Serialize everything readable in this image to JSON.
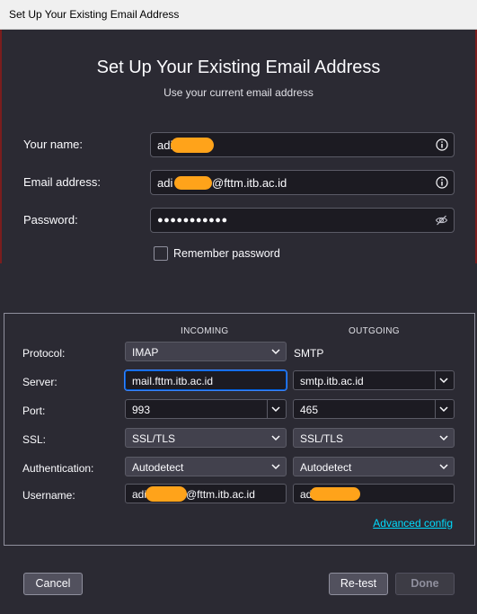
{
  "window": {
    "title": "Set Up Your Existing Email Address"
  },
  "header": {
    "title": "Set Up Your Existing Email Address",
    "subtitle": "Use your current email address"
  },
  "fields": {
    "name": {
      "label": "Your name:",
      "value": "adi"
    },
    "email": {
      "label": "Email address:",
      "value_prefix": "adi",
      "value_suffix": "@fttm.itb.ac.id"
    },
    "password": {
      "label": "Password:",
      "value": "●●●●●●●●●●●"
    }
  },
  "remember": {
    "label": "Remember password",
    "checked": false
  },
  "config": {
    "incoming_header": "INCOMING",
    "outgoing_header": "OUTGOING",
    "protocol": {
      "label": "Protocol:",
      "incoming": "IMAP",
      "outgoing": "SMTP"
    },
    "server": {
      "label": "Server:",
      "incoming": "mail.fttm.itb.ac.id",
      "outgoing": "smtp.itb.ac.id"
    },
    "port": {
      "label": "Port:",
      "incoming": "993",
      "outgoing": "465"
    },
    "ssl": {
      "label": "SSL:",
      "incoming": "SSL/TLS",
      "outgoing": "SSL/TLS"
    },
    "authentication": {
      "label": "Authentication:",
      "incoming": "Autodetect",
      "outgoing": "Autodetect"
    },
    "username": {
      "label": "Username:",
      "incoming_prefix": "adi",
      "incoming_suffix": "@fttm.itb.ac.id",
      "outgoing_prefix": "ad"
    },
    "advanced_label": "Advanced config"
  },
  "buttons": {
    "cancel": "Cancel",
    "retest": "Re-test",
    "done": "Done"
  },
  "colors": {
    "accent": "#0060df",
    "link": "#00ddff",
    "redaction": "#ffa31a",
    "background": "#2b2a33"
  },
  "icons": [
    "info-icon",
    "eye-slash-icon",
    "chevron-down-icon"
  ]
}
